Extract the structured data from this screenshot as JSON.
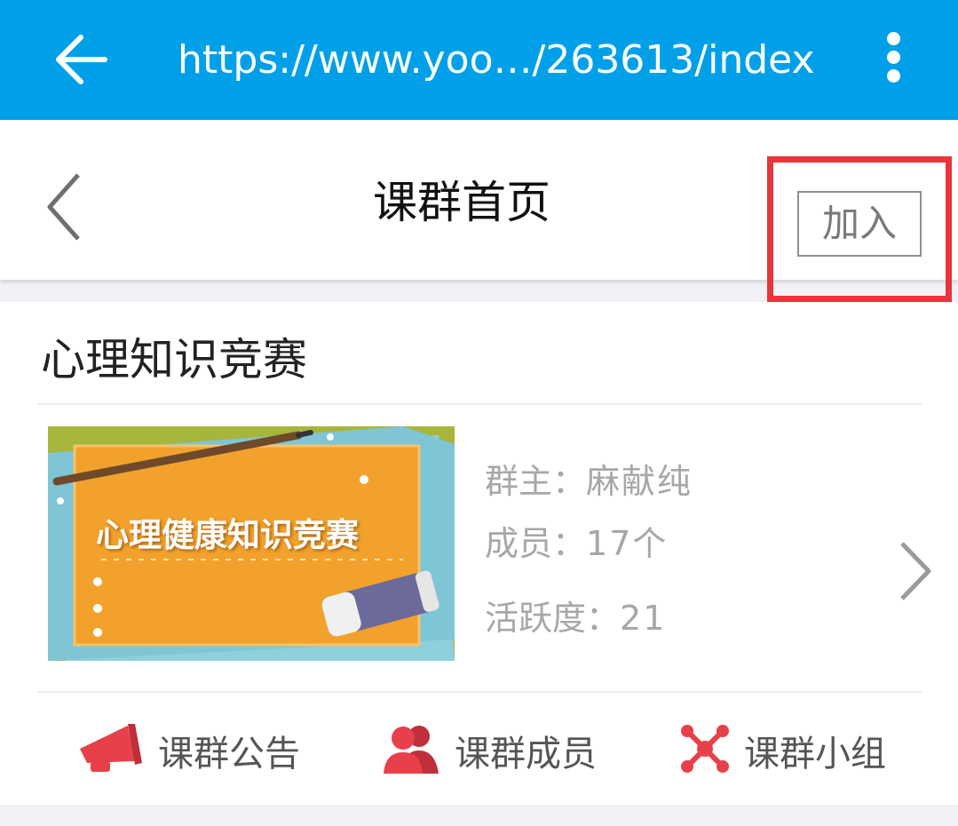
{
  "browser": {
    "url": "https://www.yoo…/263613/index",
    "back_icon": "arrow-left-icon",
    "menu_icon": "more-vertical-icon",
    "color": "#00a0e9"
  },
  "header": {
    "title": "课群首页",
    "back_icon": "chevron-left-icon",
    "join_label": "加入",
    "highlight_color": "#e8353b"
  },
  "group": {
    "name": "心理知识竞赛",
    "cover_text": "心理健康知识竞赛",
    "owner_label": "群主：",
    "owner": "麻献纯",
    "members_label": "成员：",
    "members": "17个",
    "activity_label": "活跃度：",
    "activity": "21",
    "detail_icon": "chevron-right-icon"
  },
  "actions": [
    {
      "label": "课群公告",
      "icon": "megaphone-icon"
    },
    {
      "label": "课群成员",
      "icon": "members-icon"
    },
    {
      "label": "课群小组",
      "icon": "network-icon"
    }
  ],
  "accent_color": "#e8404a"
}
